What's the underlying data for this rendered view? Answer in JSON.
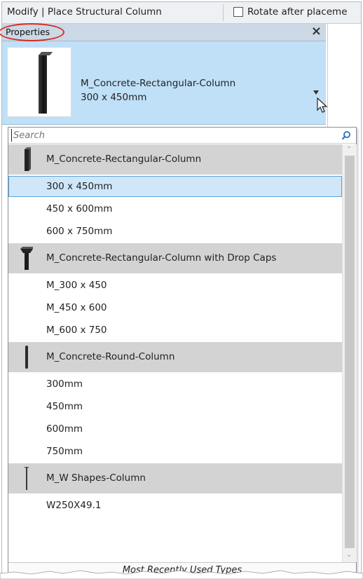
{
  "options_bar": {
    "mode_title": "Modify | Place Structural Column",
    "rotate_checkbox_label": "Rotate after placeme",
    "rotate_checked": false
  },
  "properties": {
    "title": "Properties",
    "close_glyph": "×",
    "selected_type_name": "M_Concrete-Rectangular-Column",
    "selected_type_size": "300 x 450mm"
  },
  "dropdown": {
    "search_placeholder": "Search",
    "groups": [
      {
        "family": "M_Concrete-Rectangular-Column",
        "icon": "rectangular-column-icon",
        "types": [
          "300 x 450mm",
          "450 x 600mm",
          "600 x 750mm"
        ]
      },
      {
        "family": "M_Concrete-Rectangular-Column with Drop Caps",
        "icon": "drop-cap-column-icon",
        "types": [
          "M_300 x 450",
          "M_450 x 600",
          "M_600 x 750"
        ]
      },
      {
        "family": "M_Concrete-Round-Column",
        "icon": "round-column-icon",
        "types": [
          "300mm",
          "450mm",
          "600mm",
          "750mm"
        ]
      },
      {
        "family": "M_W Shapes-Column",
        "icon": "steel-column-icon",
        "types": [
          "W250X49.1"
        ]
      }
    ],
    "selected_type": "300 x 450mm",
    "footer": "Most Recently Used Types"
  },
  "colors": {
    "type_selector_bg": "#bfe0f7",
    "selected_row_bg": "#cfe7f9",
    "group_header_bg": "#d3d3d3",
    "highlight_ring": "#d62d20"
  }
}
